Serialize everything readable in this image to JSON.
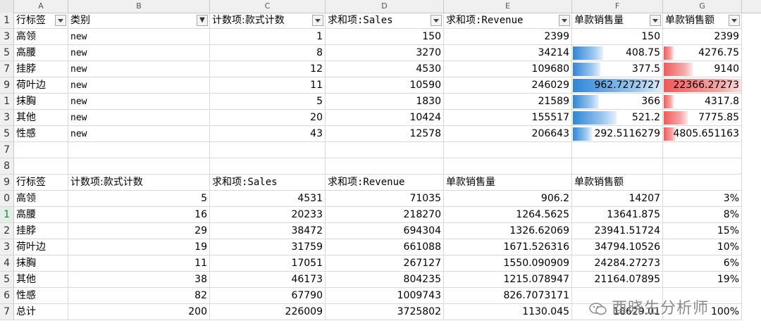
{
  "columns": [
    "A",
    "B",
    "C",
    "D",
    "E",
    "F",
    "G"
  ],
  "row_numbers": [
    "1",
    "3",
    "5",
    "7",
    "9",
    "1",
    "3",
    "5",
    "7",
    "8",
    "9",
    "0",
    "1",
    "2",
    "3",
    "4",
    "5",
    "6",
    "7"
  ],
  "pivot1": {
    "headers": [
      "行标签",
      "类别",
      "计数项:款式计数",
      "求和项:Sales",
      "求和项:Revenue",
      "单款销售量",
      "单款销售额"
    ],
    "rows": [
      {
        "label": "高领",
        "cat": "new",
        "count": "1",
        "sales": "150",
        "revenue": "2399",
        "unit_qty": "150",
        "unit_amt": "2399",
        "qty_frac": 0.0,
        "amt_frac": 0.0
      },
      {
        "label": "高腰",
        "cat": "new",
        "count": "8",
        "sales": "3270",
        "revenue": "34214",
        "unit_qty": "408.75",
        "unit_amt": "4276.75",
        "qty_frac": 0.31,
        "amt_frac": 0.09
      },
      {
        "label": "挂脖",
        "cat": "new",
        "count": "12",
        "sales": "4530",
        "revenue": "109680",
        "unit_qty": "377.5",
        "unit_amt": "9140",
        "qty_frac": 0.28,
        "amt_frac": 0.34
      },
      {
        "label": "荷叶边",
        "cat": "new",
        "count": "11",
        "sales": "10590",
        "revenue": "246029",
        "unit_qty": "962.7272727",
        "unit_amt": "22366.27273",
        "qty_frac": 1.0,
        "amt_frac": 1.0
      },
      {
        "label": "抹胸",
        "cat": "new",
        "count": "5",
        "sales": "1830",
        "revenue": "21589",
        "unit_qty": "366",
        "unit_amt": "4317.8",
        "qty_frac": 0.26,
        "amt_frac": 0.09
      },
      {
        "label": "其他",
        "cat": "new",
        "count": "20",
        "sales": "10424",
        "revenue": "155517",
        "unit_qty": "521.2",
        "unit_amt": "7775.85",
        "qty_frac": 0.46,
        "amt_frac": 0.27
      },
      {
        "label": "性感",
        "cat": "new",
        "count": "43",
        "sales": "12578",
        "revenue": "206643",
        "unit_qty": "292.5116279",
        "unit_amt": "4805.651163",
        "qty_frac": 0.18,
        "amt_frac": 0.12
      }
    ]
  },
  "pivot2": {
    "headers": [
      "行标签",
      "计数项:款式计数",
      "求和项:Sales",
      "求和项:Revenue",
      "单款销售量",
      "单款销售额"
    ],
    "rows": [
      {
        "label": "高领",
        "count": "5",
        "sales": "4531",
        "revenue": "71035",
        "unit_qty": "906.2",
        "unit_amt": "14207",
        "pct": "3%"
      },
      {
        "label": "高腰",
        "count": "16",
        "sales": "20233",
        "revenue": "218270",
        "unit_qty": "1264.5625",
        "unit_amt": "13641.875",
        "pct": "8%"
      },
      {
        "label": "挂脖",
        "count": "29",
        "sales": "38472",
        "revenue": "694304",
        "unit_qty": "1326.62069",
        "unit_amt": "23941.51724",
        "pct": "15%"
      },
      {
        "label": "荷叶边",
        "count": "19",
        "sales": "31759",
        "revenue": "661088",
        "unit_qty": "1671.526316",
        "unit_amt": "34794.10526",
        "pct": "10%"
      },
      {
        "label": "抹胸",
        "count": "11",
        "sales": "17051",
        "revenue": "267127",
        "unit_qty": "1550.090909",
        "unit_amt": "24284.27273",
        "pct": "6%"
      },
      {
        "label": "其他",
        "count": "38",
        "sales": "46173",
        "revenue": "804235",
        "unit_qty": "1215.078947",
        "unit_amt": "21164.07895",
        "pct": "19%"
      },
      {
        "label": "性感",
        "count": "82",
        "sales": "67790",
        "revenue": "1009743",
        "unit_qty": "826.7073171",
        "unit_amt": "",
        "pct": ""
      },
      {
        "label": "总计",
        "count": "200",
        "sales": "226009",
        "revenue": "3725802",
        "unit_qty": "1130.045",
        "unit_amt": "18629.01",
        "pct": "100%"
      }
    ]
  },
  "watermark": {
    "text": "酉晓生分析师"
  },
  "colors": {
    "bar_blue": "#2f86d6",
    "bar_red": "#ee5b5b"
  }
}
